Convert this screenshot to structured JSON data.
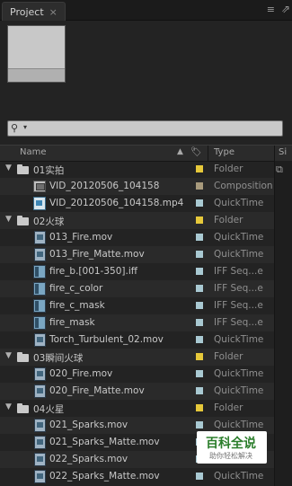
{
  "tab": {
    "title": "Project",
    "close": "×"
  },
  "panel": {
    "menu_icon": "≡",
    "maximize_icon": "⇗"
  },
  "search": {
    "icon": "⚲",
    "caret": "▾"
  },
  "header": {
    "name": "Name",
    "type": "Type",
    "size": "Si"
  },
  "colors": {
    "folder": "#e6c83a",
    "comp": "#a89a7c",
    "footage": "#a9c9d2"
  },
  "rows": [
    {
      "level": 0,
      "kind": "folder",
      "open": true,
      "name": "01实拍",
      "type": "Folder",
      "label": "folder"
    },
    {
      "level": 1,
      "kind": "comp",
      "name": "VID_20120506_104158",
      "type": "Composition",
      "label": "comp"
    },
    {
      "level": 1,
      "kind": "video",
      "name": "VID_20120506_104158.mp4",
      "type": "QuickTime",
      "label": "footage"
    },
    {
      "level": 0,
      "kind": "folder",
      "open": true,
      "name": "02火球",
      "type": "Folder",
      "label": "folder"
    },
    {
      "level": 1,
      "kind": "file",
      "name": "013_Fire.mov",
      "type": "QuickTime",
      "label": "footage"
    },
    {
      "level": 1,
      "kind": "file",
      "name": "013_Fire_Matte.mov",
      "type": "QuickTime",
      "label": "footage"
    },
    {
      "level": 1,
      "kind": "seq",
      "name": "fire_b.[001-350].iff",
      "type": "IFF Seq...e",
      "label": "footage"
    },
    {
      "level": 1,
      "kind": "seq",
      "name": "fire_c_color",
      "type": "IFF Seq...e",
      "label": "footage"
    },
    {
      "level": 1,
      "kind": "seq",
      "name": "fire_c_mask",
      "type": "IFF Seq...e",
      "label": "footage"
    },
    {
      "level": 1,
      "kind": "seq",
      "name": "fire_mask",
      "type": "IFF Seq...e",
      "label": "footage"
    },
    {
      "level": 1,
      "kind": "file",
      "name": "Torch_Turbulent_02.mov",
      "type": "QuickTime",
      "label": "footage"
    },
    {
      "level": 0,
      "kind": "folder",
      "open": true,
      "name": "03瞬间火球",
      "type": "Folder",
      "label": "folder"
    },
    {
      "level": 1,
      "kind": "file",
      "name": "020_Fire.mov",
      "type": "QuickTime",
      "label": "footage"
    },
    {
      "level": 1,
      "kind": "file",
      "name": "020_Fire_Matte.mov",
      "type": "QuickTime",
      "label": "footage"
    },
    {
      "level": 0,
      "kind": "folder",
      "open": true,
      "name": "04火星",
      "type": "Folder",
      "label": "folder"
    },
    {
      "level": 1,
      "kind": "file",
      "name": "021_Sparks.mov",
      "type": "QuickTime",
      "label": "footage"
    },
    {
      "level": 1,
      "kind": "file",
      "name": "021_Sparks_Matte.mov",
      "type": "QuickTime",
      "label": "footage"
    },
    {
      "level": 1,
      "kind": "file",
      "name": "022_Sparks.mov",
      "type": "QuickTime",
      "label": "footage"
    },
    {
      "level": 1,
      "kind": "file",
      "name": "022_Sparks_Matte.mov",
      "type": "QuickTime",
      "label": "footage"
    }
  ],
  "watermark": {
    "main": "百科全说",
    "sub": "助你轻松解决"
  }
}
